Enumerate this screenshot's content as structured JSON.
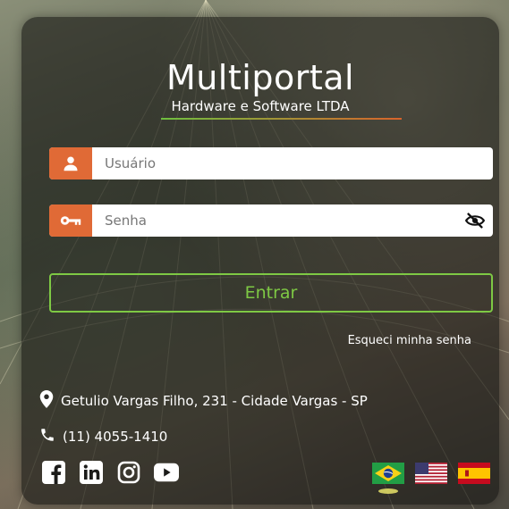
{
  "app": {
    "title": "Multiportal",
    "subtitle": "Hardware e Software LTDA"
  },
  "login": {
    "username_placeholder": "Usuário",
    "password_placeholder": "Senha",
    "submit_label": "Entrar",
    "forgot_label": "Esqueci minha senha"
  },
  "contact": {
    "address": "Getulio Vargas Filho, 231 - Cidade Vargas - SP",
    "phone": "(11) 4055-1410"
  },
  "social": [
    "facebook-icon",
    "linkedin-icon",
    "instagram-icon",
    "youtube-icon"
  ],
  "languages": [
    "pt-BR",
    "en-US",
    "es-ES"
  ],
  "colors": {
    "accent_orange": "#e06a36",
    "accent_green": "#7ec944"
  }
}
